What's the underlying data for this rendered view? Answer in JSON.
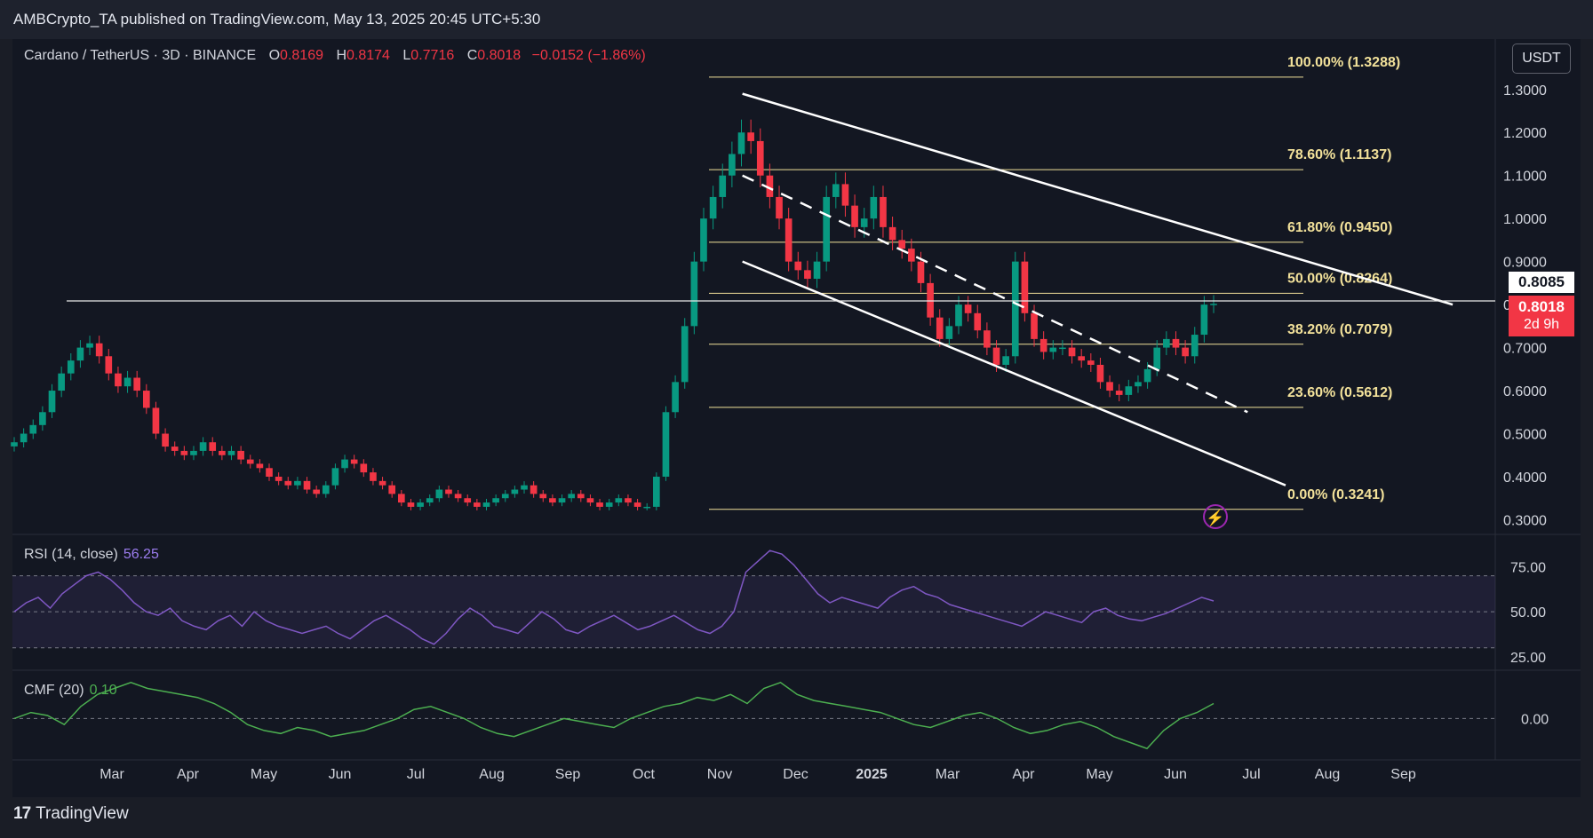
{
  "header": {
    "publisher": "AMBCrypto_TA published on TradingView.com, May 13, 2025 20:45 UTC+5:30"
  },
  "symbol": {
    "name": "Cardano / TetherUS · 3D · BINANCE",
    "o_label": "O",
    "o_value": "0.8169",
    "h_label": "H",
    "h_value": "0.8174",
    "l_label": "L",
    "l_value": "0.7716",
    "c_label": "C",
    "c_value": "0.8018",
    "change": "−0.0152 (−1.86%)"
  },
  "currency_button": "USDT",
  "price_tags": {
    "line_price": "0.8085",
    "last_price": "0.8018",
    "countdown": "2d 9h"
  },
  "rsi": {
    "label": "RSI (14, close)",
    "value": "56.25"
  },
  "cmf": {
    "label": "CMF (20)",
    "value": "0.10"
  },
  "brand": "TradingView",
  "colors": {
    "up": "#089981",
    "down": "#f23645",
    "fib": "#f2e19a",
    "rsi": "#7e57c2",
    "cmf": "#4caf50",
    "background": "#131722"
  },
  "icons": {
    "alert": "lightning-bolt-icon",
    "logo": "tradingview-logo-icon"
  },
  "chart_data": [
    {
      "type": "candlestick",
      "title": "Cardano / TetherUS · 3D · BINANCE",
      "y_ticks": [
        "1.3000",
        "1.2000",
        "1.1000",
        "1.0000",
        "0.9000",
        "0.8000",
        "0.7000",
        "0.6000",
        "0.5000",
        "0.4000",
        "0.3000"
      ],
      "x_ticks": [
        "Mar",
        "Apr",
        "May",
        "Jun",
        "Jul",
        "Aug",
        "Sep",
        "Oct",
        "Nov",
        "Dec",
        "2025",
        "Mar",
        "Apr",
        "May",
        "Jun",
        "Jul",
        "Aug",
        "Sep"
      ],
      "ylim": [
        0.27,
        1.38
      ],
      "fib_levels": [
        {
          "label": "100.00% (1.3288)",
          "price": 1.3288
        },
        {
          "label": "78.60% (1.1137)",
          "price": 1.1137
        },
        {
          "label": "61.80% (0.9450)",
          "price": 0.945
        },
        {
          "label": "50.00% (0.8264)",
          "price": 0.8264
        },
        {
          "label": "38.20% (0.7079)",
          "price": 0.7079
        },
        {
          "label": "23.60% (0.5612)",
          "price": 0.5612
        },
        {
          "label": "0.00% (0.3241)",
          "price": 0.3241
        }
      ],
      "horizontal_line": 0.8085,
      "channel": {
        "upper": [
          [
            0.5,
            1.29
          ],
          [
            17.75,
            0.8
          ]
        ],
        "mid_dashed": [
          [
            0.5,
            1.1
          ],
          [
            17.75,
            0.55
          ]
        ],
        "lower": [
          [
            0.5,
            0.9
          ],
          [
            17.75,
            0.38
          ]
        ]
      },
      "close_series": [
        0.48,
        0.5,
        0.52,
        0.55,
        0.6,
        0.64,
        0.67,
        0.7,
        0.71,
        0.68,
        0.64,
        0.61,
        0.63,
        0.6,
        0.56,
        0.5,
        0.47,
        0.46,
        0.45,
        0.46,
        0.48,
        0.46,
        0.45,
        0.46,
        0.44,
        0.43,
        0.42,
        0.4,
        0.39,
        0.38,
        0.39,
        0.37,
        0.36,
        0.38,
        0.42,
        0.44,
        0.43,
        0.41,
        0.39,
        0.38,
        0.36,
        0.34,
        0.33,
        0.34,
        0.35,
        0.37,
        0.36,
        0.35,
        0.34,
        0.33,
        0.34,
        0.35,
        0.36,
        0.37,
        0.38,
        0.36,
        0.35,
        0.34,
        0.35,
        0.36,
        0.35,
        0.34,
        0.33,
        0.34,
        0.35,
        0.34,
        0.33,
        0.33,
        0.4,
        0.55,
        0.62,
        0.75,
        0.9,
        1.0,
        1.05,
        1.1,
        1.15,
        1.2,
        1.18,
        1.1,
        1.05,
        1.0,
        0.9,
        0.88,
        0.86,
        0.9,
        1.05,
        1.08,
        1.03,
        0.98,
        1.0,
        1.05,
        0.98,
        0.95,
        0.93,
        0.9,
        0.85,
        0.77,
        0.72,
        0.75,
        0.8,
        0.78,
        0.74,
        0.7,
        0.66,
        0.68,
        0.9,
        0.78,
        0.72,
        0.69,
        0.7,
        0.7,
        0.68,
        0.67,
        0.66,
        0.62,
        0.6,
        0.59,
        0.61,
        0.62,
        0.65,
        0.7,
        0.72,
        0.7,
        0.68,
        0.73,
        0.8,
        0.8018
      ]
    },
    {
      "type": "line",
      "title": "RSI (14, close)",
      "y_ticks": [
        "75.00",
        "50.00",
        "25.00"
      ],
      "ylim": [
        20,
        90
      ],
      "bands": [
        70,
        50,
        30
      ],
      "values": [
        50,
        55,
        58,
        52,
        60,
        65,
        70,
        72,
        68,
        62,
        55,
        50,
        48,
        52,
        45,
        42,
        40,
        45,
        48,
        42,
        50,
        45,
        42,
        40,
        38,
        40,
        42,
        38,
        35,
        40,
        45,
        48,
        44,
        40,
        35,
        32,
        38,
        46,
        52,
        48,
        42,
        40,
        38,
        44,
        50,
        46,
        40,
        38,
        42,
        45,
        48,
        44,
        40,
        42,
        45,
        48,
        44,
        40,
        38,
        42,
        50,
        72,
        78,
        84,
        82,
        76,
        68,
        60,
        55,
        58,
        56,
        54,
        52,
        58,
        62,
        64,
        60,
        58,
        54,
        52,
        50,
        48,
        46,
        44,
        42,
        46,
        50,
        48,
        46,
        44,
        50,
        52,
        48,
        46,
        45,
        47,
        49,
        52,
        55,
        58,
        56
      ]
    },
    {
      "type": "line",
      "title": "CMF (20)",
      "y_ticks": [
        "0.00"
      ],
      "ylim": [
        -0.12,
        0.14
      ],
      "zero_line": 0,
      "values": [
        0.0,
        0.02,
        0.01,
        -0.02,
        0.04,
        0.08,
        0.1,
        0.12,
        0.1,
        0.09,
        0.08,
        0.07,
        0.05,
        0.02,
        -0.02,
        -0.04,
        -0.05,
        -0.03,
        -0.04,
        -0.06,
        -0.05,
        -0.04,
        -0.02,
        0.0,
        0.03,
        0.04,
        0.02,
        0.0,
        -0.03,
        -0.05,
        -0.06,
        -0.04,
        -0.02,
        0.0,
        -0.01,
        -0.02,
        -0.03,
        0.0,
        0.02,
        0.04,
        0.05,
        0.07,
        0.06,
        0.08,
        0.05,
        0.1,
        0.12,
        0.08,
        0.06,
        0.05,
        0.04,
        0.03,
        0.02,
        0.0,
        -0.02,
        -0.03,
        -0.01,
        0.01,
        0.02,
        0.0,
        -0.03,
        -0.05,
        -0.04,
        -0.02,
        -0.01,
        -0.03,
        -0.06,
        -0.08,
        -0.1,
        -0.04,
        0.0,
        0.02,
        0.05
      ]
    }
  ]
}
